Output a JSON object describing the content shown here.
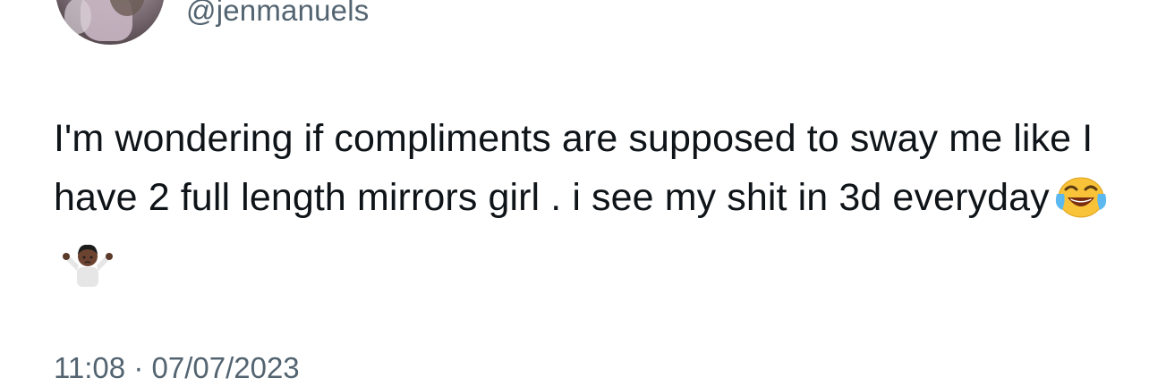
{
  "tweet": {
    "handle": "@jenmanuels",
    "text": "I'm wondering if compliments are supposed to sway me like I have 2 full length mirrors girl . i see my shit in 3d everyday",
    "emojis": [
      "face-with-tears-of-joy-icon",
      "person-shrugging-icon"
    ],
    "time": "11:08",
    "separator": "·",
    "date": "07/07/2023"
  },
  "colors": {
    "text": "#0f1419",
    "secondary": "#536471",
    "background": "#ffffff"
  }
}
